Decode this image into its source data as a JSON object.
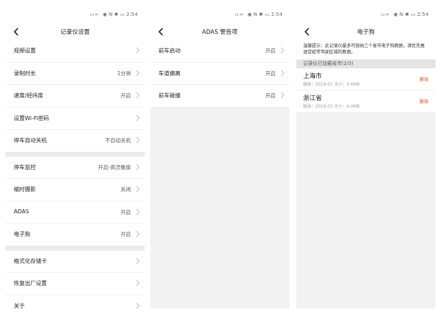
{
  "status": {
    "time": "2:54",
    "signal": "ᵢₗ ᵢₗ ≈",
    "icons": "◉ N ✱ ▭"
  },
  "screen1": {
    "title": "记录仪设置",
    "group1": [
      {
        "label": "视频设置",
        "value": ""
      },
      {
        "label": "录制时长",
        "value": "1分钟"
      },
      {
        "label": "速度/经纬度",
        "value": "开启"
      },
      {
        "label": "设置Wi-Fi密码",
        "value": ""
      },
      {
        "label": "停车自动关机",
        "value": "不自动关机"
      }
    ],
    "group2": [
      {
        "label": "停车监控",
        "value": "开启-高灵敏度"
      },
      {
        "label": "缩时摄影",
        "value": "关闭"
      },
      {
        "label": "ADAS",
        "value": "开启"
      },
      {
        "label": "电子狗",
        "value": "开启"
      }
    ],
    "group3": [
      {
        "label": "格式化存储卡",
        "value": ""
      },
      {
        "label": "恢复出厂设置",
        "value": ""
      },
      {
        "label": "关于",
        "value": ""
      }
    ]
  },
  "screen2": {
    "title": "ADAS 警告项",
    "items": [
      {
        "label": "前车启动",
        "value": "开启"
      },
      {
        "label": "车道偏离",
        "value": "开启"
      },
      {
        "label": "前车碰撞",
        "value": "开启"
      }
    ]
  },
  "screen3": {
    "title": "电子狗",
    "tip": "温馨提示：此记录仪最多可容纳三个省市电子狗数据，请优先推送您经常驾驶区域的数据。",
    "section": "记录仪已加载省市(2/3)",
    "cities": [
      {
        "name": "上海市",
        "meta": "版本：2019-01 大小：3.6MB",
        "action": "删除"
      },
      {
        "name": "浙江省",
        "meta": "版本：2019-01 大小：6.0MB",
        "action": "删除"
      }
    ]
  }
}
